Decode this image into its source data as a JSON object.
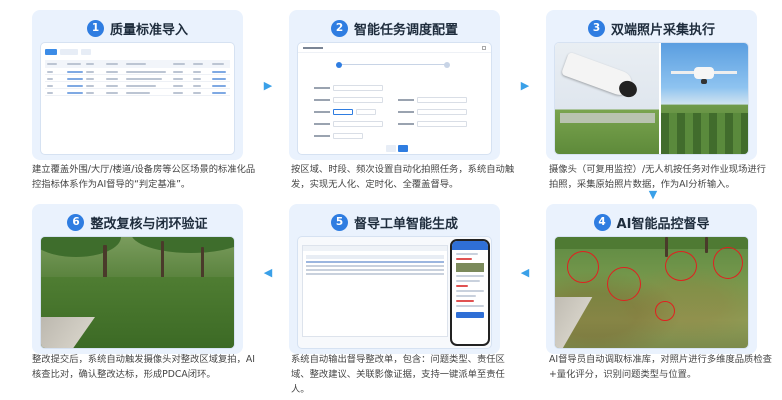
{
  "cards": [
    {
      "num": "1",
      "title": "质量标准导入",
      "desc": "建立覆盖外围/大厅/楼道/设备房等公区场景的标准化品控指标体系作为AI督导的“判定基准”。"
    },
    {
      "num": "2",
      "title": "智能任务调度配置",
      "desc": "按区域、时段、频次设置自动化拍照任务，系统自动触发，实现无人化、定时化、全覆盖督导。"
    },
    {
      "num": "3",
      "title": "双端照片采集执行",
      "desc": "摄像头（可复用监控）/无人机按任务对作业现场进行拍照，采集原始照片数据，作为AI分析输入。"
    },
    {
      "num": "4",
      "title": "AI智能品控督导",
      "desc": "AI督导员自动调取标准库，对照片进行多维度品质检查+量化评分，识别问题类型与位置。"
    },
    {
      "num": "5",
      "title": "督导工单智能生成",
      "desc": "系统自动输出督导整改单，包含：问题类型、责任区域、整改建议、关联影像证据，支持一键派单至责任人。"
    },
    {
      "num": "6",
      "title": "整改复核与闭环验证",
      "desc": "整改提交后，系统自动触发摄像头对整改区域复拍，AI核查比对，确认整改达标，形成PDCA闭环。"
    }
  ],
  "colors": {
    "accent": "#2f7de1",
    "card_bg": "#eaf2fd",
    "arrow": "#3aa0e8",
    "issue_circle": "#e02020"
  },
  "icons": {
    "arrow_right": "chevron-right-icon",
    "arrow_down": "chevron-down-icon",
    "arrow_left": "chevron-left-icon"
  }
}
